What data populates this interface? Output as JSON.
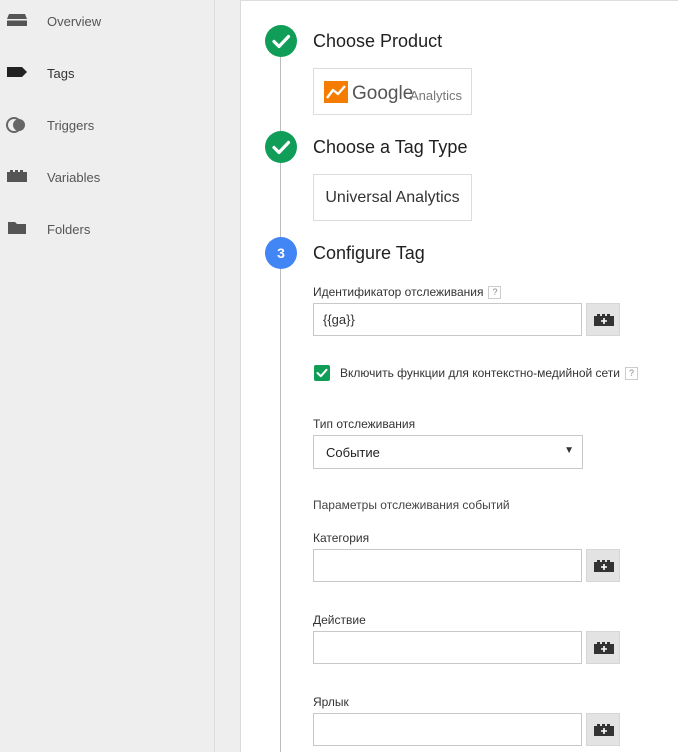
{
  "sidebar": {
    "items": [
      {
        "label": "Overview",
        "icon": "overview-icon"
      },
      {
        "label": "Tags",
        "icon": "tag-icon"
      },
      {
        "label": "Triggers",
        "icon": "triggers-icon"
      },
      {
        "label": "Variables",
        "icon": "variables-icon"
      },
      {
        "label": "Folders",
        "icon": "folder-icon"
      }
    ],
    "active": "Tags"
  },
  "steps": {
    "product": {
      "title": "Choose Product",
      "status": "done",
      "card_google": "Google",
      "card_analytics": "Analytics"
    },
    "tag_type": {
      "title": "Choose a Tag Type",
      "status": "done",
      "card_label": "Universal Analytics"
    },
    "configure": {
      "title": "Configure Tag",
      "number": "3"
    }
  },
  "form": {
    "tracking_id_label": "Идентификатор отслеживания",
    "tracking_id_value": "{{ga}}",
    "help_glyph": "?",
    "display_features_label": "Включить функции для контекстно-медийной сети",
    "display_features_checked": true,
    "track_type_label": "Тип отслеживания",
    "track_type_value": "Событие",
    "event_params_heading": "Параметры отслеживания событий",
    "category_label": "Категория",
    "category_value": "",
    "action_label": "Действие",
    "action_value": "",
    "label_label": "Ярлык",
    "label_value": ""
  },
  "colors": {
    "done_green": "#0f9d58",
    "active_blue": "#4285f4",
    "analytics_orange": "#f57c00"
  }
}
